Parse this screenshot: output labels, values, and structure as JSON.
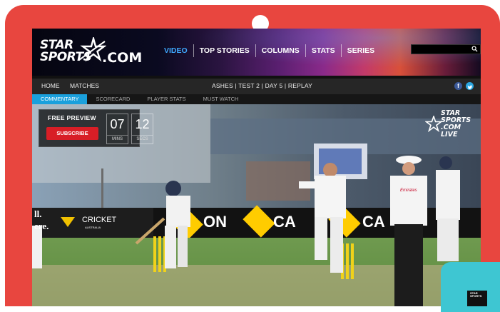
{
  "logo": {
    "line1": "STAR",
    "line2": "SPORTS",
    "domain": ".COM",
    "star_icon": "star-swoosh-icon"
  },
  "nav": [
    {
      "label": "VIDEO",
      "active": true
    },
    {
      "label": "TOP STORIES",
      "active": false
    },
    {
      "label": "COLUMNS",
      "active": false
    },
    {
      "label": "STATS",
      "active": false
    },
    {
      "label": "SERIES",
      "active": false
    }
  ],
  "search": {
    "value": "",
    "icon": "search-icon"
  },
  "subnav": {
    "home": "HOME",
    "matches": "MATCHES",
    "status": "ASHES | TEST 2 | DAY 5 | REPLAY",
    "facebook": "f"
  },
  "tabs": [
    {
      "label": "COMMENTARY",
      "active": true
    },
    {
      "label": "SCORECARD",
      "active": false
    },
    {
      "label": "PLAYER STATS",
      "active": false
    },
    {
      "label": "MUST WATCH",
      "active": false
    }
  ],
  "preview": {
    "title": "FREE PREVIEW",
    "subscribe": "SUBSCRIBE",
    "mins": "07",
    "mins_label": "MINS",
    "secs": "12",
    "secs_label": "SECS"
  },
  "bug": {
    "line1": "STAR",
    "line2": "SPORTS",
    "line3": ".COM",
    "line4": "LIVE"
  },
  "video_text": {
    "ad_left_1": "ll.",
    "ad_left_2": "ere.",
    "cricket": "CRICKET",
    "australia": "AUSTRALIA",
    "banner_1": "ON",
    "banner_2": "CA",
    "banner_3": "CA",
    "umpire_logo": "Emirates"
  },
  "thumb": {
    "l1": "STAR",
    "l2": "SPORTS"
  },
  "colors": {
    "device": "#e8463f",
    "accent": "#1aa0dc",
    "subscribe": "#d81e26"
  }
}
